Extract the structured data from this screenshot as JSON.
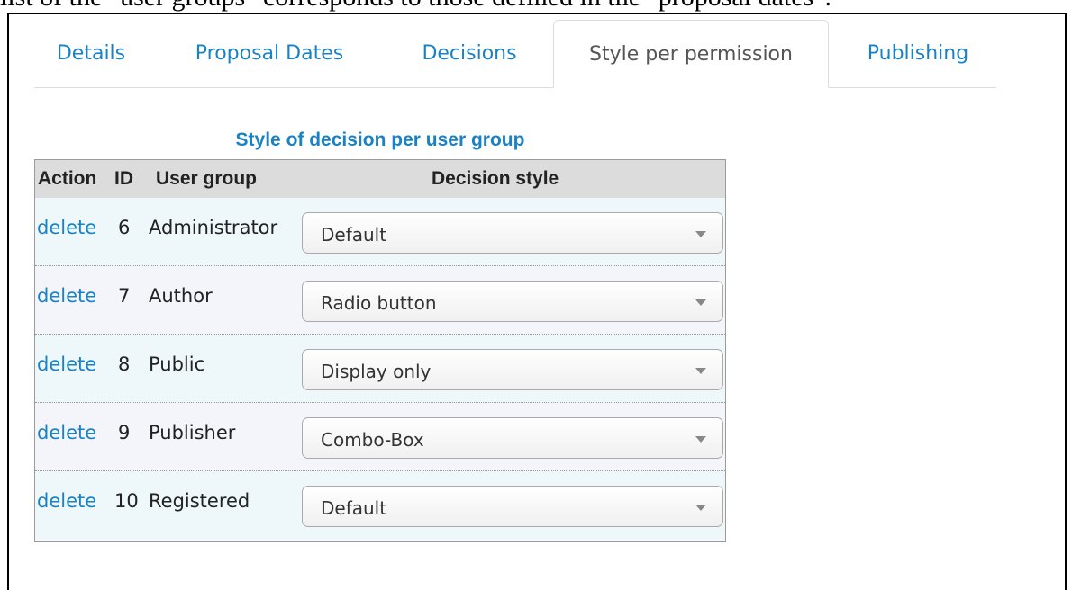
{
  "intro_text": "list of the \"user groups\" corresponds to those defined in the \"proposal dates\".",
  "tabs": [
    {
      "label": "Details",
      "active": false
    },
    {
      "label": "Proposal Dates",
      "active": false
    },
    {
      "label": "Decisions",
      "active": false
    },
    {
      "label": "Style per permission",
      "active": true
    },
    {
      "label": "Publishing",
      "active": false
    }
  ],
  "section_title": "Style of decision per user group",
  "table": {
    "headers": {
      "action": "Action",
      "id": "ID",
      "group": "User group",
      "style": "Decision style"
    },
    "rows": [
      {
        "action": "delete",
        "id": "6",
        "group": "Administrator",
        "style": "Default"
      },
      {
        "action": "delete",
        "id": "7",
        "group": "Author",
        "style": "Radio button"
      },
      {
        "action": "delete",
        "id": "8",
        "group": "Public",
        "style": "Display only"
      },
      {
        "action": "delete",
        "id": "9",
        "group": "Publisher",
        "style": "Combo-Box"
      },
      {
        "action": "delete",
        "id": "10",
        "group": "Registered",
        "style": "Default"
      }
    ]
  },
  "colors": {
    "link": "#1a82c4",
    "header_bg": "#dcdcdc",
    "row_bg": "#eef8fb"
  }
}
